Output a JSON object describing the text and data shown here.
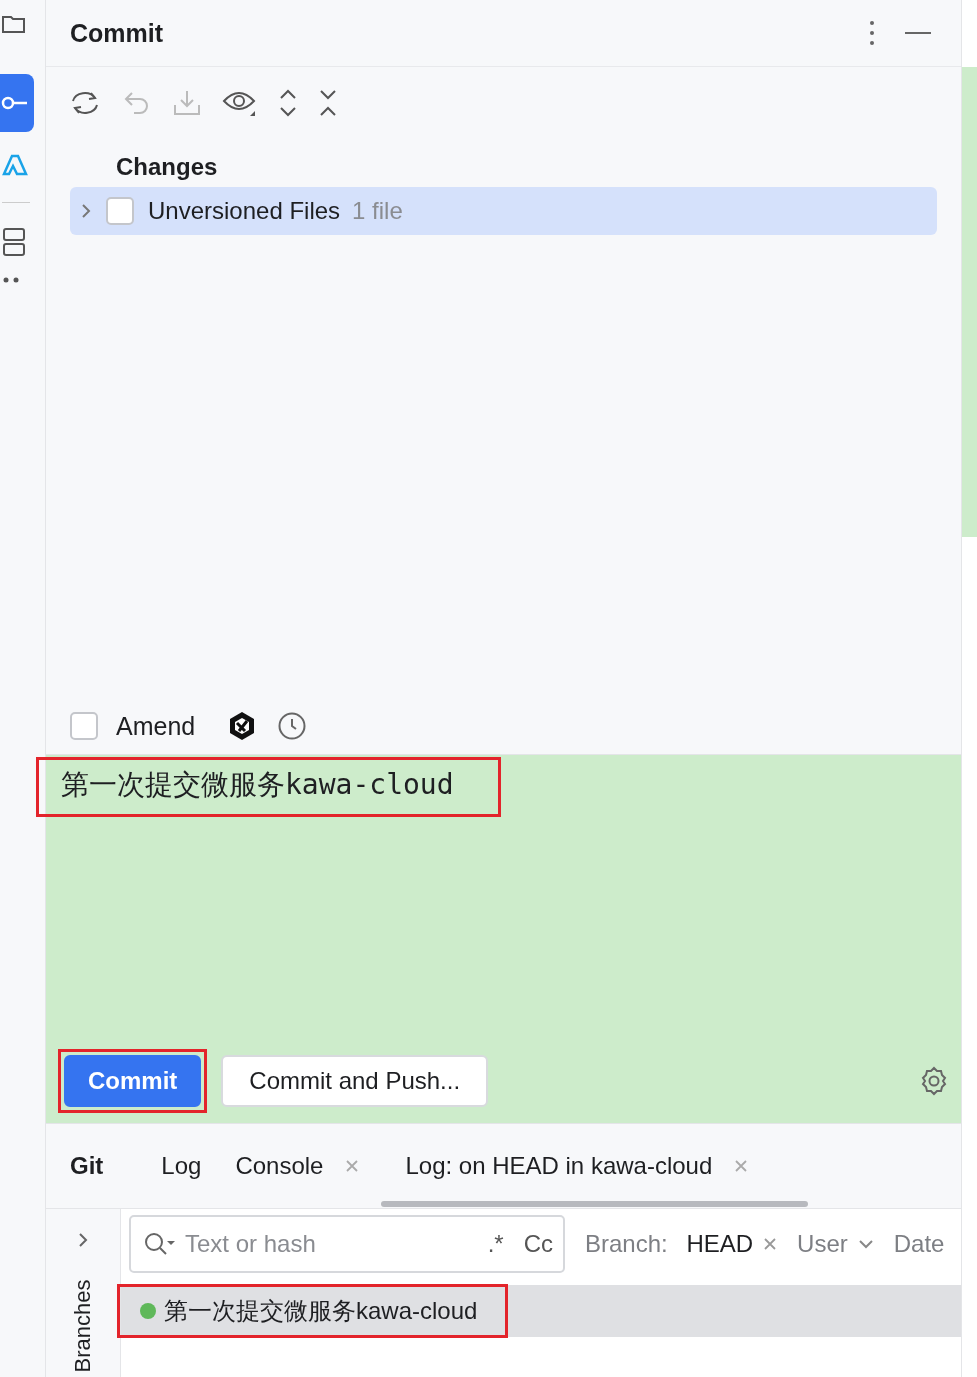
{
  "panel": {
    "title": "Commit"
  },
  "changes": {
    "heading": "Changes",
    "groups": [
      {
        "label": "Unversioned Files",
        "count": "1 file",
        "expanded": false,
        "checked": false,
        "selected": true
      }
    ]
  },
  "amend": {
    "label": "Amend",
    "checked": false
  },
  "message": {
    "text": "第一次提交微服务kawa-cloud",
    "highlighted": true
  },
  "buttons": [
    {
      "label": "Commit",
      "primary": true,
      "highlighted": true
    },
    {
      "label": "Commit and Push...",
      "primary": false,
      "highlighted": false
    }
  ],
  "bottom_tabs": [
    {
      "label": "Git",
      "kind": "title"
    },
    {
      "label": "Log",
      "kind": "tab",
      "closable": false,
      "selected": false
    },
    {
      "label": "Console",
      "kind": "tab",
      "closable": true,
      "selected": false
    },
    {
      "label": "Log: on HEAD in kawa-cloud",
      "kind": "tab",
      "closable": true,
      "selected": true
    }
  ],
  "log": {
    "side_label": "Branches",
    "search_placeholder": "Text or hash",
    "regex": ".*",
    "case": "Cc",
    "filters": [
      {
        "label": "Branch:",
        "value": "HEAD",
        "kind": "clearable"
      },
      {
        "label": "User",
        "kind": "dropdown"
      },
      {
        "label": "Date",
        "kind": "plain"
      }
    ],
    "commits": [
      {
        "message": "第一次提交微服务kawa-cloud",
        "color": "#5fb85a",
        "selected": true,
        "highlighted": true
      }
    ]
  }
}
